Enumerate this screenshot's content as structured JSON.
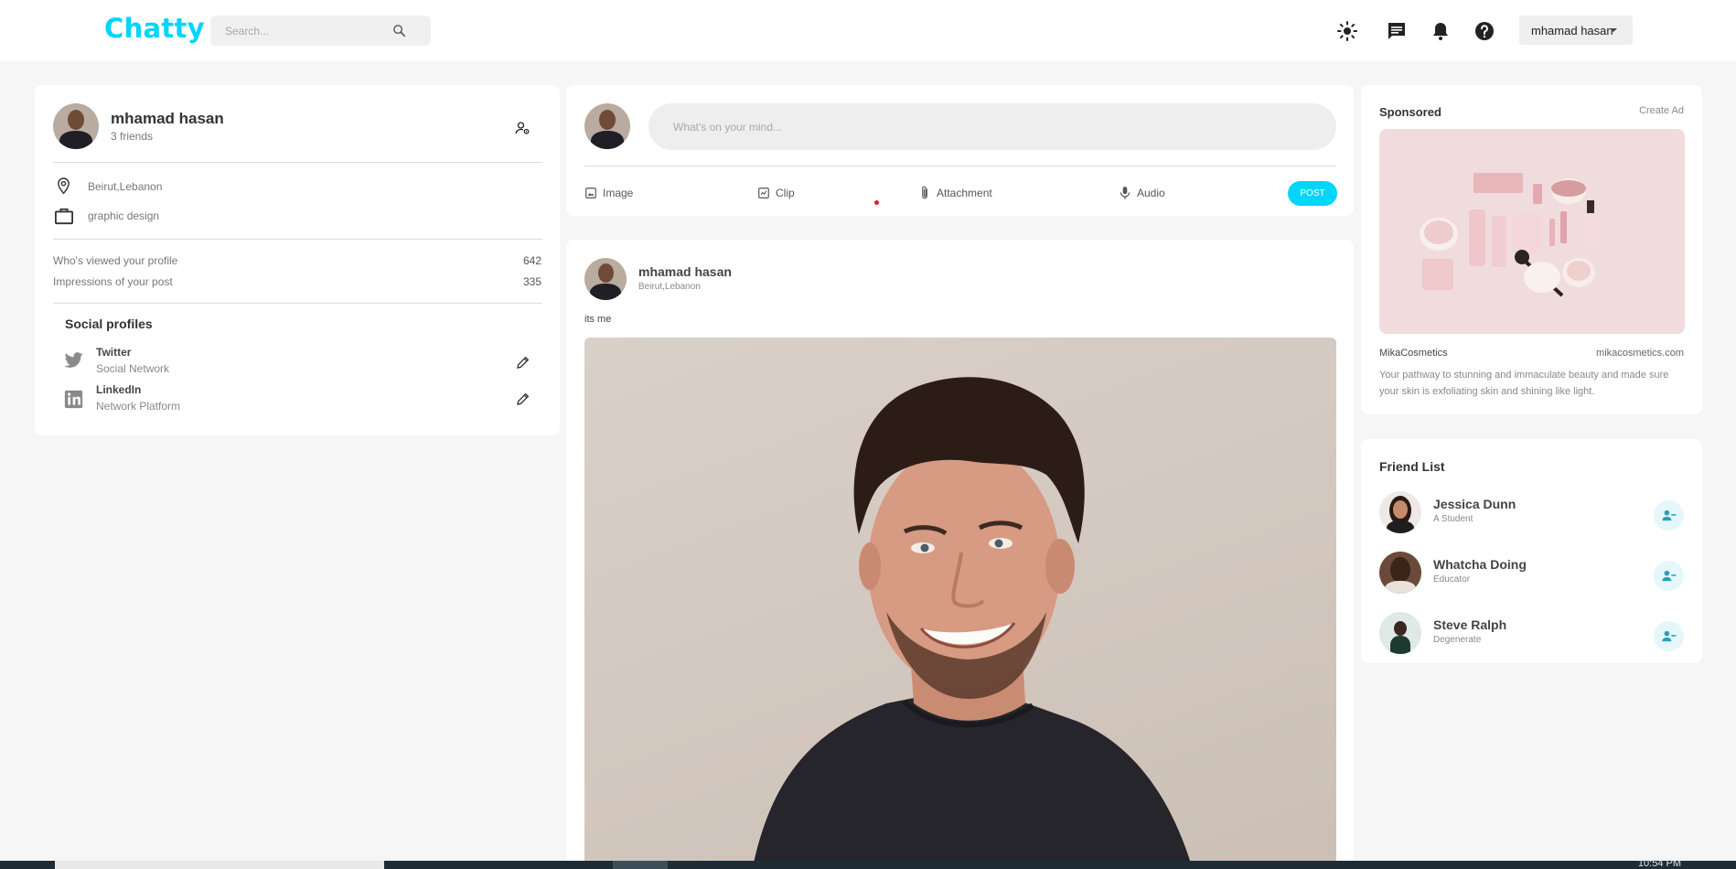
{
  "header": {
    "logo": "Chatty",
    "search_placeholder": "Search...",
    "icons": [
      "sun-icon",
      "chat-icon",
      "bell-icon",
      "help-icon"
    ],
    "user_menu_label": "mhamad hasan"
  },
  "profile": {
    "name": "mhamad hasan",
    "friends": "3 friends",
    "location": "Beirut,Lebanon",
    "occupation": "graphic design",
    "stats": [
      {
        "label": "Who's viewed your profile",
        "value": "642"
      },
      {
        "label": "Impressions of your post",
        "value": "335"
      }
    ],
    "social_title": "Social profiles",
    "socials": [
      {
        "name": "Twitter",
        "sub": "Social Network",
        "icon": "twitter-icon"
      },
      {
        "name": "LinkedIn",
        "sub": "Network Platform",
        "icon": "linkedin-icon"
      }
    ]
  },
  "composer": {
    "placeholder": "What's on your mind...",
    "actions": [
      {
        "label": "Image",
        "icon": "image-icon"
      },
      {
        "label": "Clip",
        "icon": "clip-icon"
      },
      {
        "label": "Attachment",
        "icon": "paperclip-icon"
      },
      {
        "label": "Audio",
        "icon": "mic-icon"
      }
    ],
    "post_label": "POST"
  },
  "post": {
    "author": "mhamad hasan",
    "location": "Beirut,Lebanon",
    "text": "its me"
  },
  "sponsored": {
    "title": "Sponsored",
    "create_ad": "Create Ad",
    "name": "MikaCosmetics",
    "url": "mikacosmetics.com",
    "description": "Your pathway to stunning and immaculate beauty and made sure your skin is exfoliating skin and shining like light."
  },
  "friend_list": {
    "title": "Friend List",
    "friends": [
      {
        "name": "Jessica Dunn",
        "sub": "A Student"
      },
      {
        "name": "Whatcha Doing",
        "sub": "Educator"
      },
      {
        "name": "Steve Ralph",
        "sub": "Degenerate"
      }
    ]
  },
  "taskbar": {
    "clock": "10:54 PM"
  },
  "colors": {
    "accent": "#00d5fa",
    "page_bg": "#f6f6f6",
    "card_bg": "#ffffff"
  }
}
